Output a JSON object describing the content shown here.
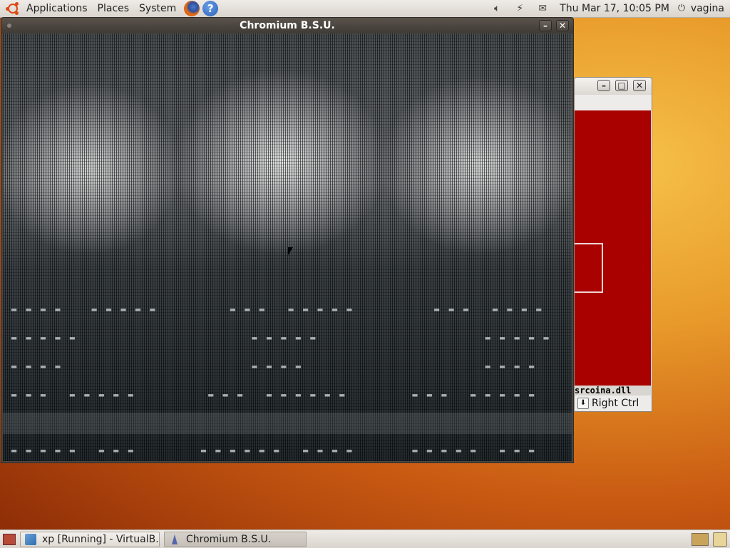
{
  "top_panel": {
    "menus": [
      "Applications",
      "Places",
      "System"
    ],
    "clock": "Thu Mar 17, 10:05 PM",
    "user": "vagina"
  },
  "chromium_window": {
    "title": "Chromium B.S.U.",
    "minimize_symbol": "–",
    "close_symbol": "✕"
  },
  "vbox_window": {
    "minimize_symbol": "–",
    "maximize_symbol": "□",
    "close_symbol": "✕",
    "status_text": "srcoina.dll",
    "host_key": "Right Ctrl"
  },
  "taskbar": {
    "tasks": [
      {
        "label": "xp [Running] - VirtualB..."
      },
      {
        "label": "Chromium B.S.U."
      }
    ]
  },
  "colors": {
    "vbox_screen": "#a90000",
    "panel": "#e4dfd9"
  },
  "icons": {
    "distro_logo": "ubuntu-logo-icon",
    "browser": "firefox-icon",
    "help": "help-icon",
    "volume": "volume-icon",
    "network": "network-icon",
    "mail": "mail-icon",
    "power": "power-icon"
  }
}
